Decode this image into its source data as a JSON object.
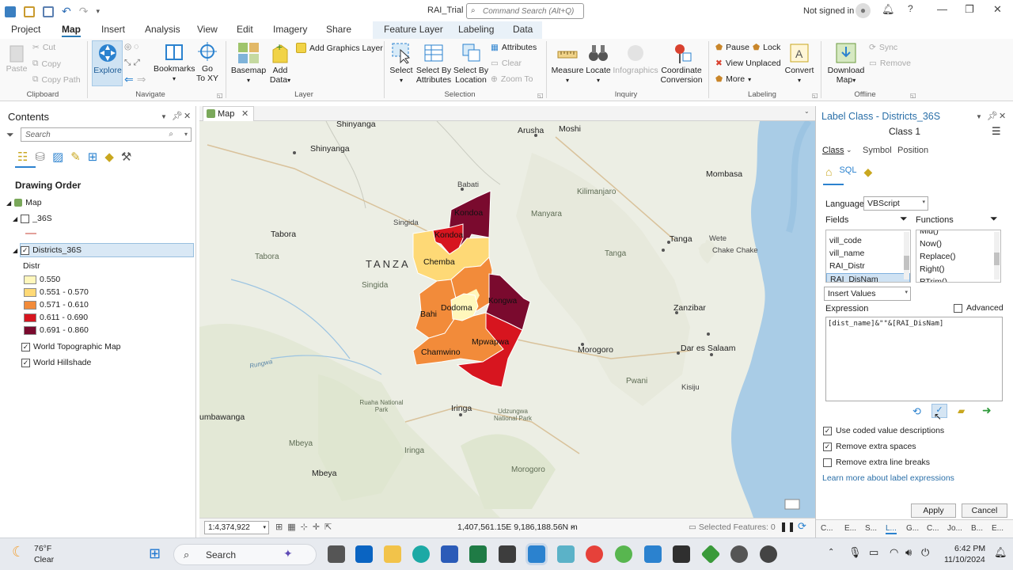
{
  "titlebar": {
    "title": "RAI_Trial",
    "search_placeholder": "Command Search (Alt+Q)",
    "signin": "Not signed in"
  },
  "tabs": [
    "Project",
    "Map",
    "Insert",
    "Analysis",
    "View",
    "Edit",
    "Imagery",
    "Share",
    "Feature Layer",
    "Labeling",
    "Data"
  ],
  "active_tab": "Map",
  "ribbon": {
    "clipboard": {
      "paste": "Paste",
      "cut": "Cut",
      "copy": "Copy",
      "copy_path": "Copy Path",
      "label": "Clipboard"
    },
    "navigate": {
      "explore": "Explore",
      "bookmarks": "Bookmarks",
      "goto_1": "Go",
      "goto_2": "To XY",
      "label": "Navigate"
    },
    "layer": {
      "basemap": "Basemap",
      "add_data_1": "Add",
      "add_data_2": "Data",
      "add_graphics": "Add Graphics Layer",
      "label": "Layer"
    },
    "selection": {
      "select": "Select",
      "select_by_attr_1": "Select By",
      "select_by_attr_2": "Attributes",
      "select_by_loc_1": "Select By",
      "select_by_loc_2": "Location",
      "attributes": "Attributes",
      "clear": "Clear",
      "zoom_to": "Zoom To",
      "label": "Selection"
    },
    "inquiry": {
      "measure": "Measure",
      "locate": "Locate",
      "infographics": "Infographics",
      "coord_1": "Coordinate",
      "coord_2": "Conversion",
      "label": "Inquiry"
    },
    "labeling": {
      "pause": "Pause",
      "lock": "Lock",
      "view_unplaced": "View Unplaced",
      "more": "More",
      "convert": "Convert",
      "label": "Labeling"
    },
    "offline": {
      "download_1": "Download",
      "download_2": "Map",
      "sync": "Sync",
      "remove": "Remove",
      "label": "Offline"
    }
  },
  "contents": {
    "title": "Contents",
    "search_placeholder": "Search",
    "drawing_order": "Drawing Order",
    "map": "Map",
    "layer_36s": "_36S",
    "districts": "Districts_36S",
    "field": "Distr",
    "classes": [
      {
        "label": "0.550",
        "color": "#fff7bc"
      },
      {
        "label": "0.551 - 0.570",
        "color": "#fed976"
      },
      {
        "label": "0.571 - 0.610",
        "color": "#f28b3a"
      },
      {
        "label": "0.611 - 0.690",
        "color": "#d7151f"
      },
      {
        "label": "0.691 - 0.860",
        "color": "#7a0a2e"
      }
    ],
    "basemaps": [
      "World Topographic Map",
      "World Hillshade"
    ]
  },
  "map_view": {
    "tab": "Map",
    "scale": "1:4,374,922",
    "coords": "1,407,561.15E 9,186,188.56N m",
    "selected": "Selected Features: 0",
    "places": {
      "shinyanga_n": "Shinyanga",
      "shinyanga": "Shinyanga",
      "arusha": "Arusha",
      "moshi": "Moshi",
      "kilimanjaro": "Kilimanjaro",
      "babati": "Babati",
      "manyara": "Manyara",
      "singida": "Singida",
      "singida_r": "Singida",
      "tabora": "Tabora",
      "tabora_r": "Tabora",
      "tanza": "TANZA",
      "mombasa": "Mombasa",
      "tanga": "Tanga",
      "tanga_r": "Tanga",
      "wete": "Wete",
      "chake": "Chake Chake",
      "zanzibar": "Zanzibar",
      "dar": "Dar es Salaam",
      "morogoro": "Morogoro",
      "morogoro_r": "Morogoro",
      "pwani": "Pwani",
      "kisiju": "Kisiju",
      "iringa": "Iringa",
      "iringa_r": "Iringa",
      "ruaha": "Ruaha National Park",
      "udzungwa": "Udzungwa National Park",
      "mbeya": "Mbeya",
      "mbeya_r": "Mbeya",
      "umbawanga": "umbawanga",
      "rungwa": "Rungwa"
    },
    "districts": [
      "Kondoa",
      "Kondoa",
      "Chemba",
      "Dodoma",
      "Bahi",
      "Kongwa",
      "Mpwapwa",
      "Chamwino"
    ]
  },
  "label_pane": {
    "title": "Label Class - Districts_36S",
    "class": "Class 1",
    "subtabs": [
      "Class",
      "Symbol",
      "Position"
    ],
    "language_label": "Language",
    "language": "VBScript",
    "fields_label": "Fields",
    "functions_label": "Functions",
    "fields": [
      "vill_code",
      "vill_name",
      "RAI_Distr",
      "RAI_DisNam"
    ],
    "functions": [
      "Mid()",
      "Now()",
      "Replace()",
      "Right()",
      "RTrim()"
    ],
    "insert_values": "Insert Values",
    "expression_label": "Expression",
    "advanced": "Advanced",
    "expression": "[dist_name]&\"\"&[RAI_DisNam]",
    "opt1": "Use coded value descriptions",
    "opt2": "Remove extra spaces",
    "opt3": "Remove extra line breaks",
    "learn": "Learn more about label expressions",
    "apply": "Apply",
    "cancel": "Cancel",
    "bottom_tabs": [
      "C...",
      "E...",
      "S...",
      "L...",
      "G...",
      "C...",
      "Jo...",
      "B...",
      "E..."
    ]
  },
  "taskbar": {
    "temp": "76°F",
    "weather": "Clear",
    "search": "Search",
    "time": "6:42 PM",
    "date": "11/10/2024"
  }
}
